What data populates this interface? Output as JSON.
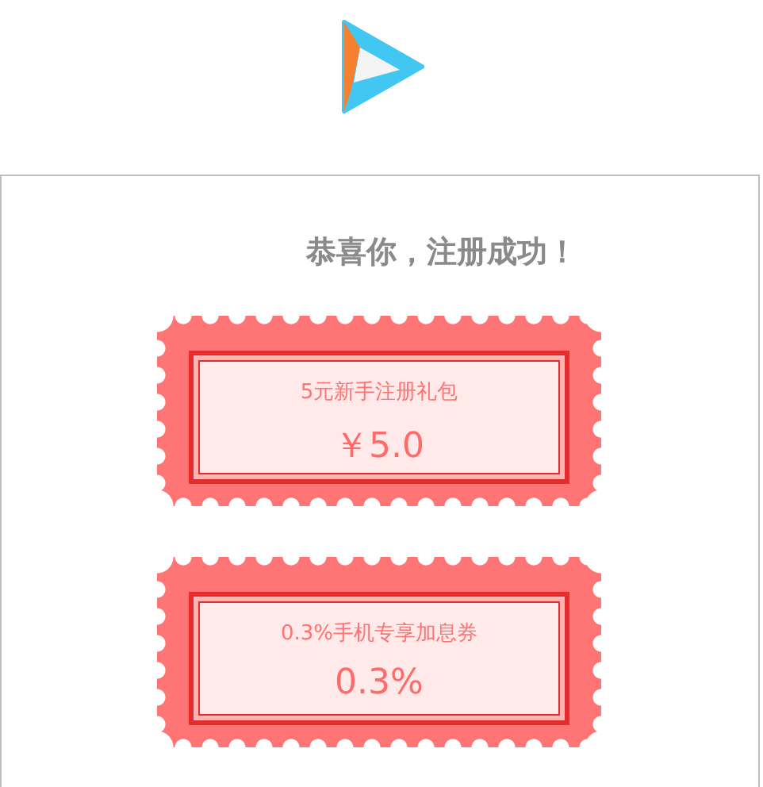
{
  "title": "恭喜你，注册成功！",
  "coupons": [
    {
      "name": "5元新手注册礼包",
      "value": "￥5.0"
    },
    {
      "name": "0.3%手机专享加息券",
      "value": "0.3%"
    }
  ]
}
